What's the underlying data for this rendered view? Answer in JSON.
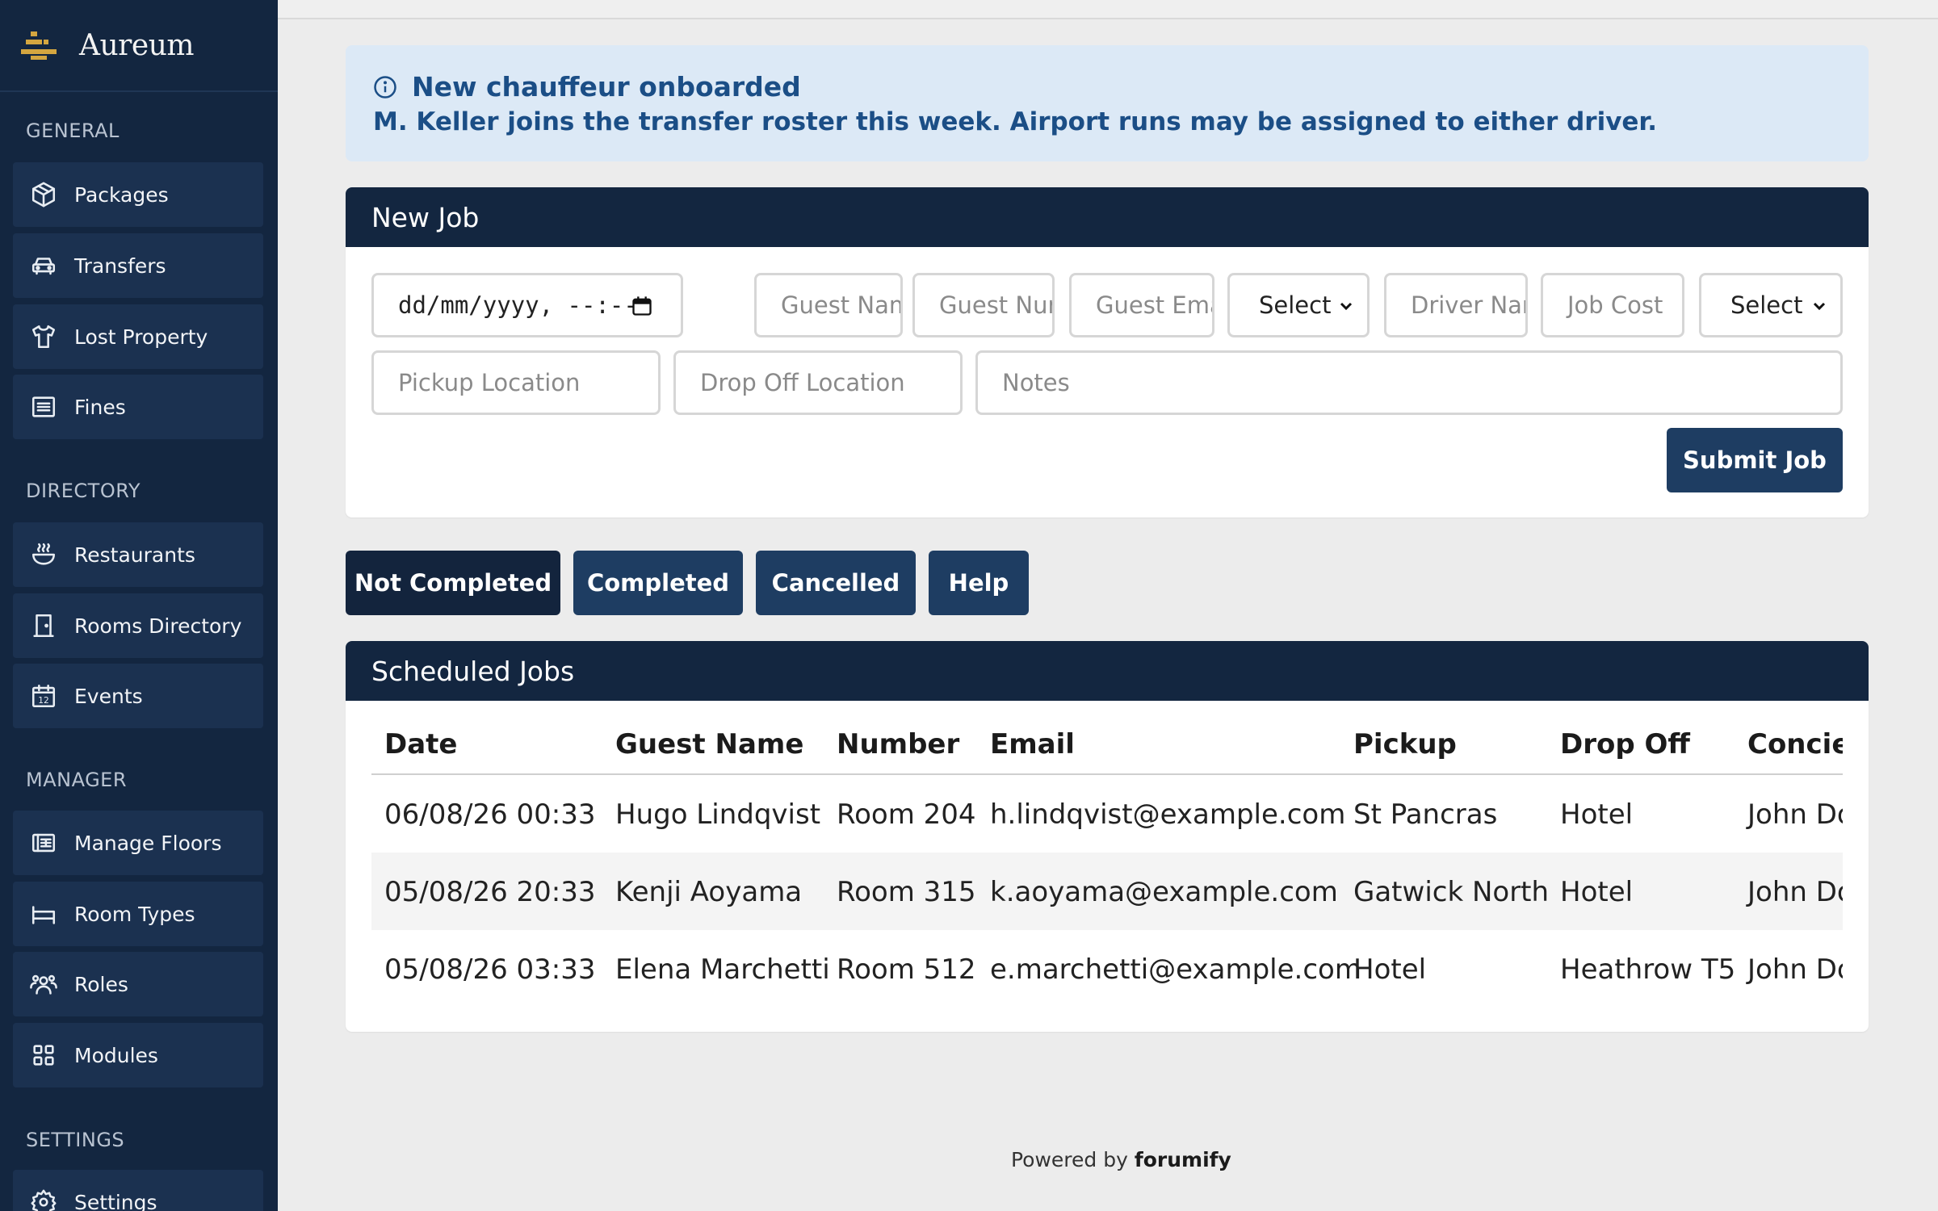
{
  "sidebar": {
    "brand": "Aureum",
    "sections": [
      "GENERAL",
      "DIRECTORY",
      "MANAGER",
      "SETTINGS"
    ],
    "items": [
      {
        "label": "Packages",
        "icon": "package-icon"
      },
      {
        "label": "Transfers",
        "icon": "car-icon"
      },
      {
        "label": "Lost Property",
        "icon": "shirt-icon"
      },
      {
        "label": "Fines",
        "icon": "list-icon"
      },
      {
        "label": "Restaurants",
        "icon": "bowl-icon"
      },
      {
        "label": "Rooms Directory",
        "icon": "door-icon"
      },
      {
        "label": "Events",
        "icon": "calendar-icon"
      },
      {
        "label": "Manage Floors",
        "icon": "floor-plan-icon"
      },
      {
        "label": "Room Types",
        "icon": "bed-icon"
      },
      {
        "label": "Roles",
        "icon": "users-icon"
      },
      {
        "label": "Modules",
        "icon": "grid-icon"
      },
      {
        "label": "Settings",
        "icon": "gear-icon"
      }
    ]
  },
  "alert": {
    "title": "New chauffeur onboarded",
    "message": "M. Keller joins the transfer roster this week. Airport runs may be assigned to either driver."
  },
  "new_job": {
    "title": "New Job",
    "date_value": "dd/mm/yyyy, --:--",
    "guest_name_placeholder": "Guest Name",
    "guest_number_placeholder": "Guest Number",
    "guest_email_placeholder": "Guest Email",
    "select1_value": "Select",
    "driver_placeholder": "Driver Name",
    "job_cost_placeholder": "Job Cost",
    "select2_value": "Select",
    "pickup_placeholder": "Pickup Location",
    "dropoff_placeholder": "Drop Off Location",
    "notes_placeholder": "Notes",
    "submit_label": "Submit Job"
  },
  "filters": {
    "not_completed": "Not Completed",
    "completed": "Completed",
    "cancelled": "Cancelled",
    "help": "Help"
  },
  "scheduled": {
    "title": "Scheduled Jobs",
    "columns": [
      "Date",
      "Guest Name",
      "Number",
      "Email",
      "Pickup",
      "Drop Off",
      "Concierge"
    ],
    "rows": [
      [
        "06/08/26 00:33",
        "Hugo Lindqvist",
        "Room 204",
        "h.lindqvist@example.com",
        "St Pancras",
        "Hotel",
        "John Doe"
      ],
      [
        "05/08/26 20:33",
        "Kenji Aoyama",
        "Room 315",
        "k.aoyama@example.com",
        "Gatwick North",
        "Hotel",
        "John Doe"
      ],
      [
        "05/08/26 03:33",
        "Elena Marchetti",
        "Room 512",
        "e.marchetti@example.com",
        "Hotel",
        "Heathrow T5",
        "John Doe"
      ]
    ]
  },
  "footer": {
    "prefix": "Powered by",
    "brand": "forumify"
  },
  "colors": {
    "sidebar": "#132640",
    "accent": "#1e3d62",
    "alert_bg": "#dce9f6",
    "logo_gold": "#d4a640"
  }
}
